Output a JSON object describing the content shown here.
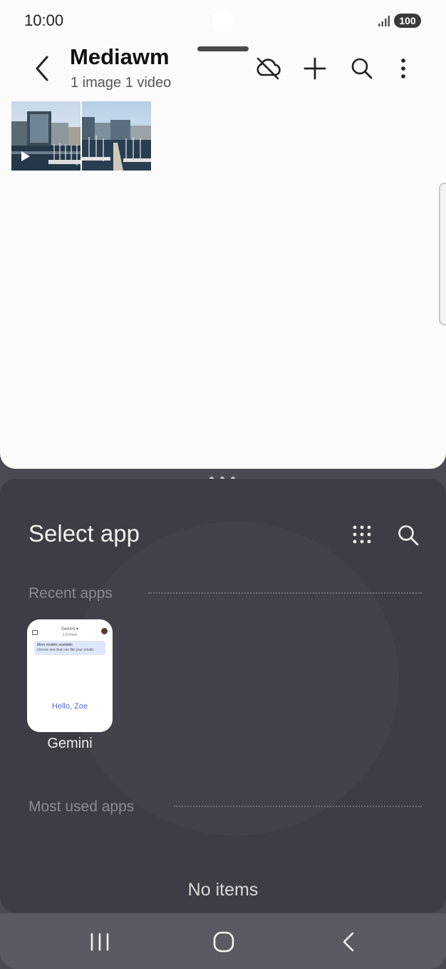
{
  "status_bar": {
    "time": "10:00",
    "battery": "100"
  },
  "album": {
    "title": "Mediawm",
    "subtitle": "1 image 1 video"
  },
  "toolbar_icons": [
    "cloud-off-icon",
    "add-icon",
    "search-icon",
    "more-vert-icon"
  ],
  "thumbnails": [
    {
      "name": "video-thumbnail",
      "kind": "video"
    },
    {
      "name": "image-thumbnail",
      "kind": "image"
    }
  ],
  "panel": {
    "title": "Select app",
    "recent_label": "Recent apps",
    "most_used_label": "Most used apps",
    "empty_text": "No items",
    "recent_apps": [
      {
        "label": "Gemini",
        "preview": {
          "top": "Gemini ▾",
          "sub": "2.0 Flash",
          "line1": "More models available",
          "line2": "choose one that can file your emails",
          "hello": "Hello, Zoe"
        }
      }
    ]
  },
  "colors": {
    "pane_top": "#fbfbfb",
    "pane_bottom": "#3d3d45",
    "navbar": "#5a5a62"
  }
}
